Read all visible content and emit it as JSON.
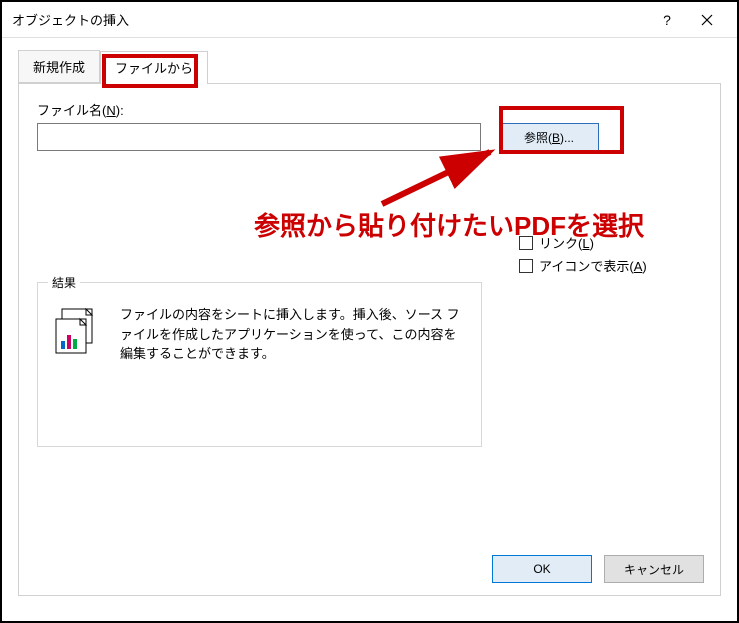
{
  "title": "オブジェクトの挿入",
  "help_symbol": "?",
  "tabs": {
    "create_new": "新規作成",
    "from_file": "ファイルから"
  },
  "filename": {
    "label_prefix": "ファイル名(",
    "label_key": "N",
    "label_suffix": "):",
    "value": ""
  },
  "browse": {
    "label_prefix": "参照(",
    "label_key": "B",
    "label_suffix": ")..."
  },
  "link_checkbox": {
    "label_prefix": "リンク(",
    "label_key": "L",
    "label_suffix": ")"
  },
  "icon_checkbox": {
    "label_prefix": "アイコンで表示(",
    "label_key": "A",
    "label_suffix": ")"
  },
  "result": {
    "legend": "結果",
    "text": "ファイルの内容をシートに挿入します。挿入後、ソース ファイルを作成したアプリケーションを使って、この内容を編集することができます。"
  },
  "annotation_text": "参照から貼り付けたいPDFを選択",
  "buttons": {
    "ok": "OK",
    "cancel": "キャンセル"
  }
}
